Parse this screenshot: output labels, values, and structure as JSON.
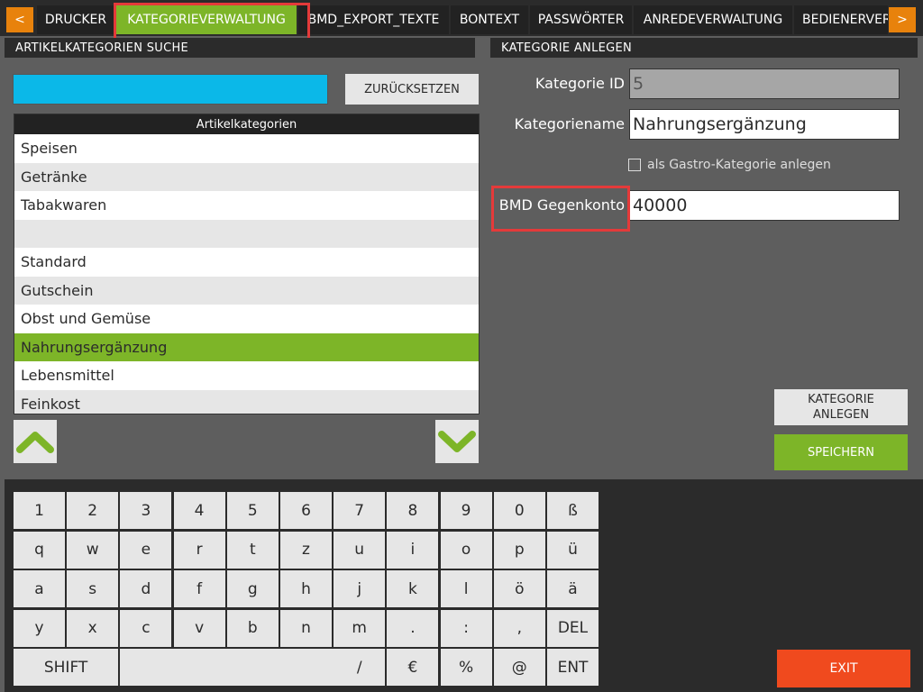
{
  "tabs": {
    "prev": "<",
    "next": ">",
    "items": [
      "DRUCKER",
      "KATEGORIEVERWALTUNG",
      "BMD_EXPORT_TEXTE",
      "BONTEXT",
      "PASSWÖRTER",
      "ANREDEVERWALTUNG",
      "BEDIENERVER"
    ]
  },
  "search": {
    "header": "ARTIKELKATEGORIEN SUCHE",
    "value": "",
    "reset_label": "ZURÜCKSETZEN"
  },
  "list": {
    "header": "Artikelkategorien",
    "rows": [
      "Speisen",
      "Getränke",
      "Tabakwaren",
      "",
      "Standard",
      "Gutschein",
      "Obst und Gemüse",
      "Nahrungsergänzung",
      "Lebensmittel",
      "Feinkost"
    ],
    "selected_index": 7
  },
  "form": {
    "header": "KATEGORIE ANLEGEN",
    "id_label": "Kategorie ID",
    "id_value": "5",
    "name_label": "Kategoriename",
    "name_value": "Nahrungsergänzung",
    "gastro_label": "als Gastro-Kategorie anlegen",
    "gastro_checked": false,
    "bmd_label": "BMD Gegenkonto",
    "bmd_value": "40000",
    "create_label": "KATEGORIE ANLEGEN",
    "save_label": "SPEICHERN",
    "exit_label": "EXIT"
  },
  "keyboard": {
    "rows": [
      [
        "1",
        "2",
        "3",
        "4",
        "5",
        "6",
        "7",
        "8",
        "9",
        "0",
        "ß"
      ],
      [
        "q",
        "w",
        "e",
        "r",
        "t",
        "z",
        "u",
        "i",
        "o",
        "p",
        "ü"
      ],
      [
        "a",
        "s",
        "d",
        "f",
        "g",
        "h",
        "j",
        "k",
        "l",
        "ö",
        "ä"
      ],
      [
        "y",
        "x",
        "c",
        "v",
        "b",
        "n",
        "m",
        ".",
        ":",
        ",",
        "DEL"
      ]
    ],
    "last_row": {
      "shift": "SHIFT",
      "space": "",
      "keys": [
        "/",
        "€",
        "%",
        "@",
        "ENT"
      ]
    }
  },
  "colors": {
    "accent_green": "#7db528",
    "search_blue": "#0bb8e8",
    "arrow_orange": "#e8820c",
    "exit_red": "#f04a1e",
    "highlight_red": "#e43a3a"
  }
}
